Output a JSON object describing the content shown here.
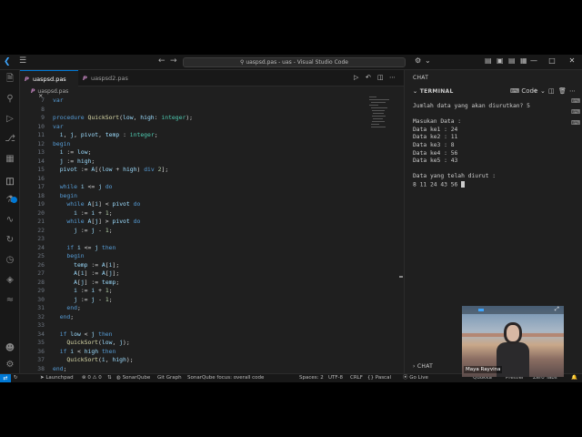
{
  "window": {
    "search": "uaspsd.pas - uas - Visual Studio Code"
  },
  "tabs": [
    {
      "label": "uaspsd.pas",
      "icon": "P"
    },
    {
      "label": "uaspsd2.pas",
      "icon": "P"
    }
  ],
  "breadcrumb": {
    "file": "uaspsd.pas",
    "icon": "P"
  },
  "code_lines": [
    {
      "n": "7",
      "text": "var"
    },
    {
      "n": "8",
      "text": ""
    },
    {
      "n": "9",
      "text": "procedure QuickSort(low, high: integer);"
    },
    {
      "n": "10",
      "text": "var"
    },
    {
      "n": "11",
      "text": "  i, j, pivot, temp : integer;"
    },
    {
      "n": "12",
      "text": "begin"
    },
    {
      "n": "13",
      "text": "  i := low;"
    },
    {
      "n": "14",
      "text": "  j := high;"
    },
    {
      "n": "15",
      "text": "  pivot := A[(low + high) div 2];"
    },
    {
      "n": "16",
      "text": ""
    },
    {
      "n": "17",
      "text": "  while i <= j do"
    },
    {
      "n": "18",
      "text": "  begin"
    },
    {
      "n": "19",
      "text": "    while A[i] < pivot do"
    },
    {
      "n": "20",
      "text": "      i := i + 1;"
    },
    {
      "n": "21",
      "text": "    while A[j] > pivot do"
    },
    {
      "n": "22",
      "text": "      j := j - 1;"
    },
    {
      "n": "23",
      "text": ""
    },
    {
      "n": "24",
      "text": "    if i <= j then"
    },
    {
      "n": "25",
      "text": "    begin"
    },
    {
      "n": "26",
      "text": "      temp := A[i];"
    },
    {
      "n": "27",
      "text": "      A[i] := A[j];"
    },
    {
      "n": "28",
      "text": "      A[j] := temp;"
    },
    {
      "n": "29",
      "text": "      i := i + 1;"
    },
    {
      "n": "30",
      "text": "      j := j - 1;"
    },
    {
      "n": "31",
      "text": "    end;"
    },
    {
      "n": "32",
      "text": "  end;"
    },
    {
      "n": "33",
      "text": ""
    },
    {
      "n": "34",
      "text": "  if low < j then"
    },
    {
      "n": "35",
      "text": "    QuickSort(low, j);"
    },
    {
      "n": "36",
      "text": "  if i < high then"
    },
    {
      "n": "37",
      "text": "    QuickSort(i, high);"
    },
    {
      "n": "38",
      "text": "end;"
    }
  ],
  "panel": {
    "chat_title": "CHAT",
    "terminal_title": "TERMINAL",
    "terminal_profile": "Code",
    "chat_footer": "CHAT"
  },
  "terminal_lines": [
    "Jumlah data yang akan diurutkan? 5",
    "",
    "Masukan Data :",
    "Data ke1 : 24",
    "Data ke2 : 11",
    "Data ke3 : 8",
    "Data ke4 : 56",
    "Data ke5 : 43",
    "",
    "Data yang telah diurut :",
    "8 11 24 43 56 "
  ],
  "webcam": {
    "name": "Maya Rayvina"
  },
  "statusbar": {
    "launchpad": "Launchpad",
    "problems": "0",
    "warnings": "0",
    "sonarqube": "SonarQube",
    "git_graph": "Git Graph",
    "sonar_focus": "SonarQube focus: overall code",
    "spaces": "Spaces: 2",
    "encoding": "UTF-8",
    "eol": "CRLF",
    "language": "Pascal",
    "golive": "Go Live",
    "quokka": "Quokka",
    "prettier": "Prettier",
    "zero_tabs": "Zero Tabs"
  },
  "colors": {
    "keyword": "#569cd6",
    "function": "#dcdcaa",
    "type": "#4ec9b0",
    "identifier": "#9cdcfe",
    "number": "#b5cea8",
    "accent": "#0078d4"
  }
}
